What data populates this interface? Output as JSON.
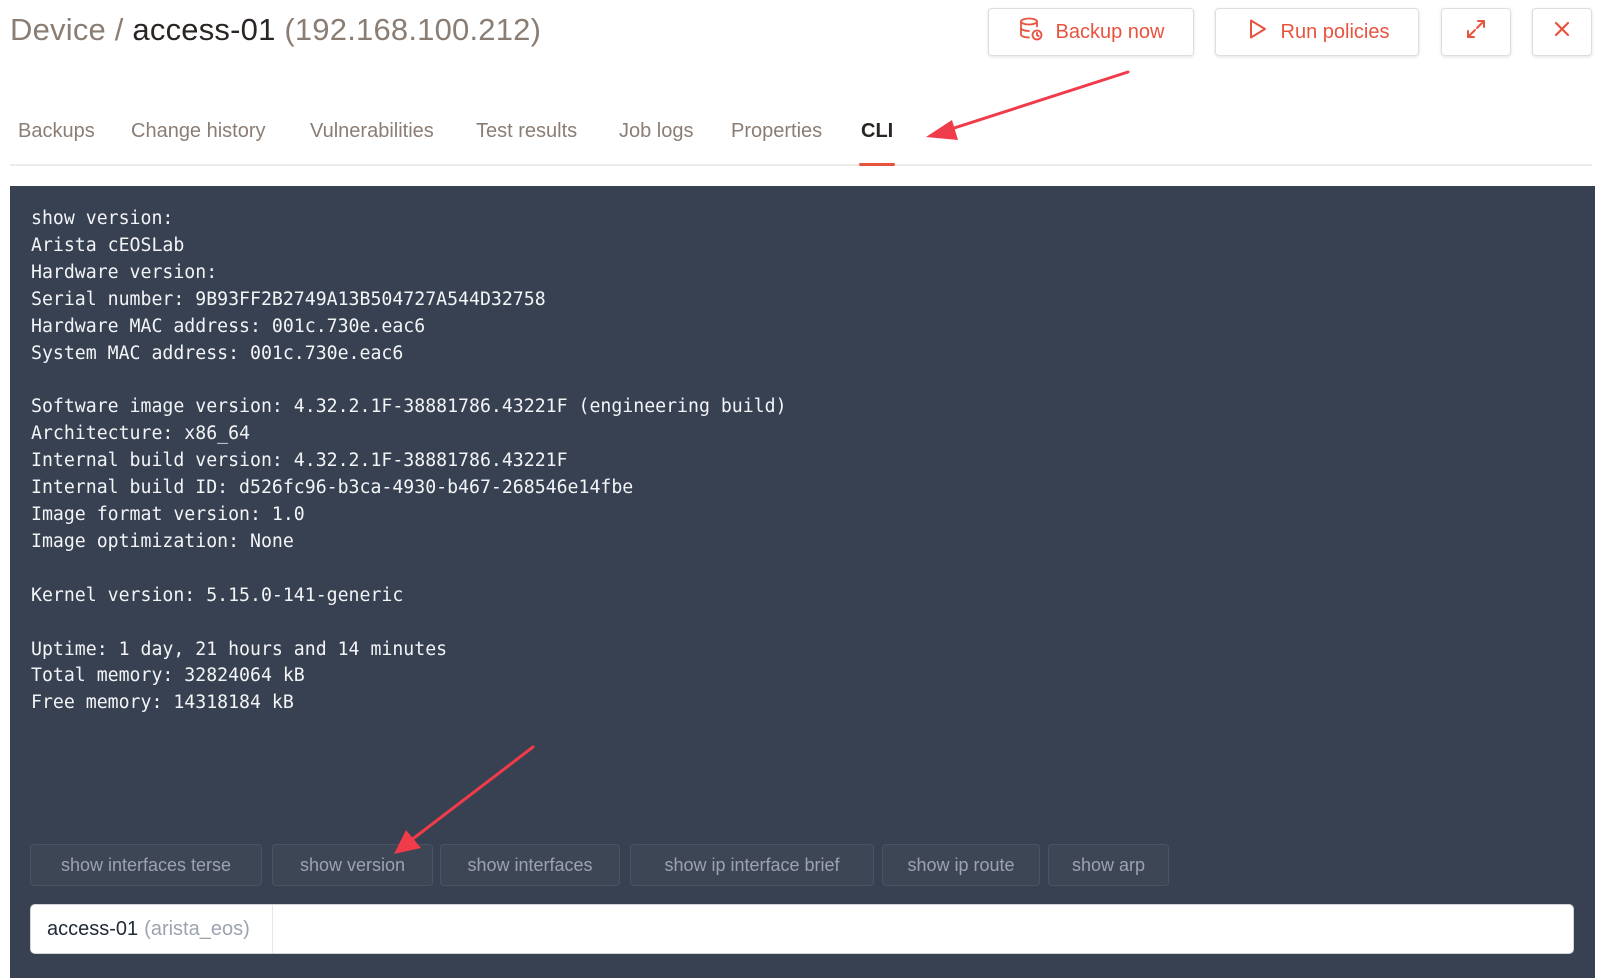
{
  "header": {
    "prefix": "Device /",
    "device_name": "access-01",
    "device_ip": "(192.168.100.212)"
  },
  "toolbar": {
    "backup_label": "Backup now",
    "backup_icon": "database-sync-icon",
    "run_label": "Run policies",
    "run_icon": "play-icon",
    "expand_icon": "expand-icon",
    "close_icon": "close-icon",
    "accent_color": "#e8533f"
  },
  "tabs": [
    {
      "label": "Backups"
    },
    {
      "label": "Change history"
    },
    {
      "label": "Vulnerabilities"
    },
    {
      "label": "Test results"
    },
    {
      "label": "Job logs"
    },
    {
      "label": "Properties"
    },
    {
      "label": "CLI",
      "active": true
    }
  ],
  "cli": {
    "output": "show version:\nArista cEOSLab\nHardware version:\nSerial number: 9B93FF2B2749A13B504727A544D32758\nHardware MAC address: 001c.730e.eac6\nSystem MAC address: 001c.730e.eac6\n\nSoftware image version: 4.32.2.1F-38881786.43221F (engineering build)\nArchitecture: x86_64\nInternal build version: 4.32.2.1F-38881786.43221F\nInternal build ID: d526fc96-b3ca-4930-b467-268546e14fbe\nImage format version: 1.0\nImage optimization: None\n\nKernel version: 5.15.0-141-generic\n\nUptime: 1 day, 21 hours and 14 minutes\nTotal memory: 32824064 kB\nFree memory: 14318184 kB",
    "quick_commands": [
      "show interfaces terse",
      "show version",
      "show interfaces",
      "show ip interface brief",
      "show ip route",
      "show arp"
    ],
    "prompt_device": "access-01",
    "prompt_type": "(arista_eos)",
    "input_value": "",
    "background_color": "#374151"
  },
  "annotations": {
    "arrow_color": "#ef3b4a"
  }
}
